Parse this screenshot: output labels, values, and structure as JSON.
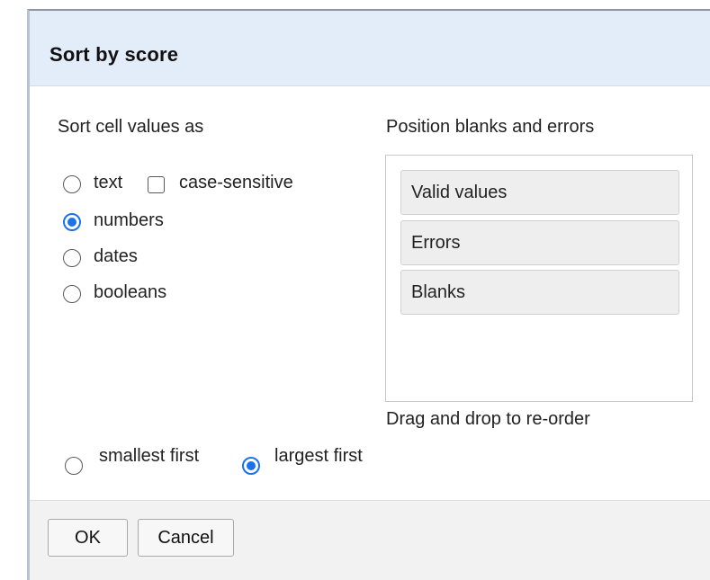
{
  "dialog": {
    "title": "Sort by score"
  },
  "sort_as": {
    "heading": "Sort cell values as",
    "options": [
      {
        "label": "text",
        "checked": false
      },
      {
        "label": "numbers",
        "checked": true
      },
      {
        "label": "dates",
        "checked": false
      },
      {
        "label": "booleans",
        "checked": false
      }
    ],
    "case_sensitive": {
      "label": "case-sensitive",
      "checked": false
    }
  },
  "blanks_errors": {
    "heading": "Position blanks and errors",
    "items": [
      "Valid values",
      "Errors",
      "Blanks"
    ],
    "hint": "Drag and drop to re-order"
  },
  "direction": {
    "options": [
      {
        "label": "smallest first",
        "checked": false
      },
      {
        "label": "largest first",
        "checked": true
      }
    ]
  },
  "footer": {
    "ok_label": "OK",
    "cancel_label": "Cancel"
  },
  "colors": {
    "titlebar_bg": "#e3ecf9",
    "accent": "#1a73e8",
    "footer_bg": "#f2f2f2"
  }
}
